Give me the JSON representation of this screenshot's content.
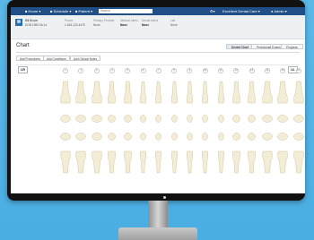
{
  "topbar": {
    "menu_1": "Home",
    "menu_2": "Schedule",
    "menu_3": "Patient",
    "search_placeholder": "Search",
    "practice": "Excellent Dental Care",
    "user": "Admin"
  },
  "patient": {
    "name": "Bill Brown",
    "id": "DOB 1983-06-14",
    "phone_label": "Phone",
    "phone": "1-815-123-4475",
    "primary_provider_label": "Primary Provider",
    "primary_provider": "None",
    "medical_alerts_label": "Medical Alerts",
    "medical_alerts": "None",
    "dental_alerts_label": "Dental Alerts",
    "dental_alerts": "None",
    "lab_label": "Lab",
    "lab": "None"
  },
  "chart": {
    "title": "Chart",
    "tabs": [
      "Dental Chart",
      "Periodontal Exams",
      "Progress"
    ],
    "tools": [
      "Add Procedures",
      "Add Conditions",
      "Add Clinical Notes"
    ],
    "corner_left": "UR",
    "corner_right": "UL",
    "tooth_numbers": [
      "1",
      "2",
      "3",
      "4",
      "5",
      "6",
      "7",
      "8",
      "9",
      "10",
      "11",
      "12",
      "13",
      "14",
      "15",
      "16"
    ]
  },
  "colors": {
    "nav": "#1f4f86",
    "accent": "#2a6db0",
    "tooth": "#f4edd5",
    "background": "#4aaee3"
  }
}
